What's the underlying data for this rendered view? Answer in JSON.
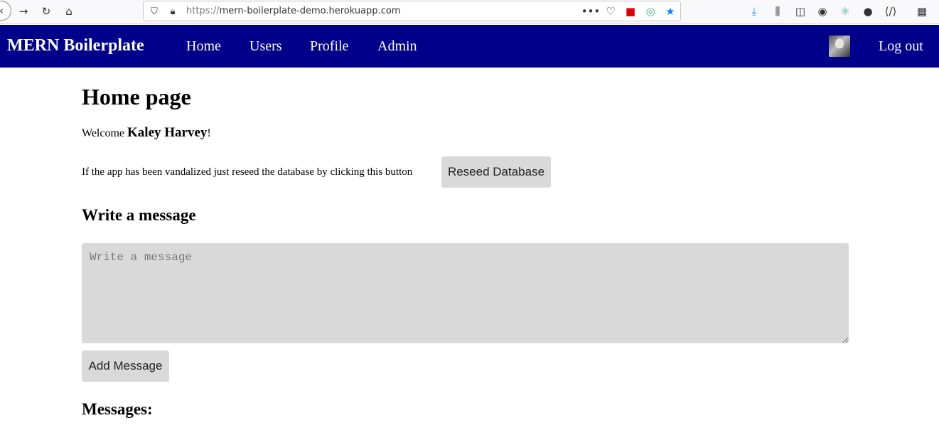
{
  "browser": {
    "url_scheme": "https://",
    "url_host": "mern-boilerplate-demo.herokuapp.com"
  },
  "navbar": {
    "brand": "MERN Boilerplate",
    "links": [
      "Home",
      "Users",
      "Profile",
      "Admin"
    ],
    "logout": "Log out",
    "background_color": "#00008b"
  },
  "home": {
    "title": "Home page",
    "welcome_prefix": "Welcome ",
    "user_name": "Kaley Harvey",
    "welcome_suffix": "!",
    "reseed_text": "If the app has been vandalized just reseed the database by clicking this button",
    "reseed_button": "Reseed Database",
    "write_title": "Write a message",
    "message_placeholder": "Write a message",
    "message_value": "",
    "add_button": "Add Message",
    "messages_title": "Messages:"
  }
}
